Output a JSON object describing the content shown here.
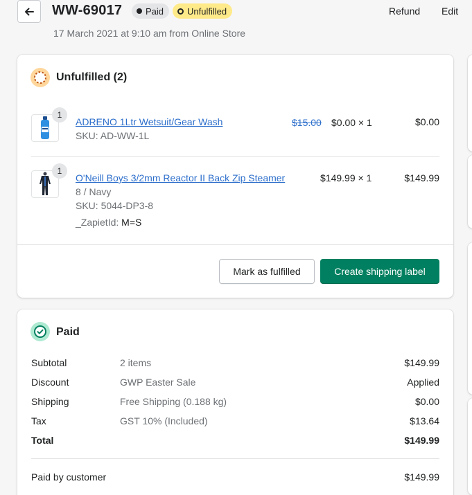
{
  "header": {
    "order_number": "WW-69017",
    "badge_paid": "Paid",
    "badge_unfulfilled": "Unfulfilled",
    "refund_label": "Refund",
    "edit_label": "Edit",
    "subtitle": "17 March 2021 at 9:10 am from Online Store"
  },
  "unfulfilled": {
    "title": "Unfulfilled (2)",
    "items": [
      {
        "qty_badge": "1",
        "name": "ADRENO 1Ltr Wetsuit/Gear Wash",
        "sku": "SKU: AD-WW-1L",
        "original_price": "$15.00",
        "price_qty": "$0.00 × 1",
        "total": "$0.00"
      },
      {
        "qty_badge": "1",
        "name": "O'Neill Boys 3/2mm Reactor II Back Zip Steamer",
        "variant": "8 / Navy",
        "sku": "SKU: 5044-DP3-8",
        "prop_label": "_ZapietId:",
        "prop_value": "M=S",
        "price_qty": "$149.99 × 1",
        "total": "$149.99"
      }
    ],
    "mark_fulfilled_label": "Mark as fulfilled",
    "create_label_label": "Create shipping label"
  },
  "paid": {
    "title": "Paid",
    "rows": [
      {
        "label": "Subtotal",
        "desc": "2 items",
        "value": "$149.99"
      },
      {
        "label": "Discount",
        "desc": "GWP Easter Sale",
        "value": "Applied"
      },
      {
        "label": "Shipping",
        "desc": "Free Shipping (0.188 kg)",
        "value": "$0.00"
      },
      {
        "label": "Tax",
        "desc": "GST 10% (Included)",
        "value": "$13.64"
      },
      {
        "label": "Total",
        "desc": "",
        "value": "$149.99"
      }
    ],
    "paid_by_label": "Paid by customer",
    "paid_by_value": "$149.99"
  },
  "icons": {
    "back": "arrow-left-icon",
    "unfulfilled": "dashed-circle-icon",
    "paid": "check-circle-icon"
  },
  "colors": {
    "primary": "#008060",
    "link": "#2c6ecb",
    "unfulfilled_badge": "#ffea8a",
    "paid_badge": "#e4e5e7"
  }
}
